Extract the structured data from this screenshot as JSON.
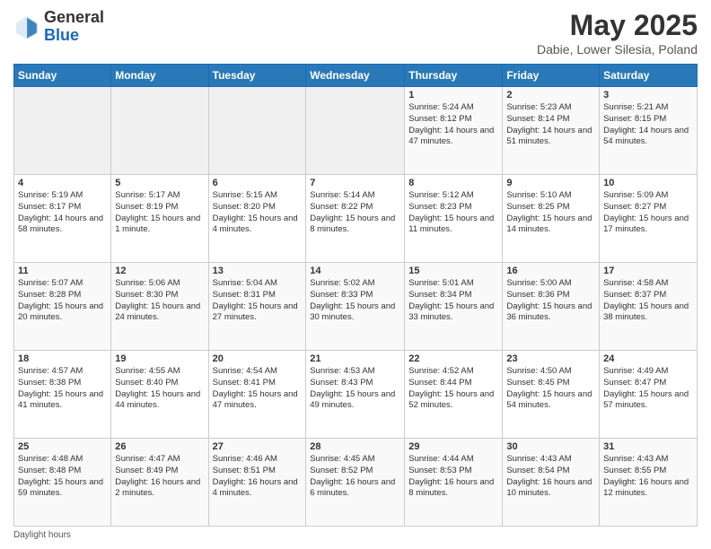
{
  "header": {
    "logo_general": "General",
    "logo_blue": "Blue",
    "month_title": "May 2025",
    "location": "Dabie, Lower Silesia, Poland"
  },
  "days_of_week": [
    "Sunday",
    "Monday",
    "Tuesday",
    "Wednesday",
    "Thursday",
    "Friday",
    "Saturday"
  ],
  "weeks": [
    [
      {
        "num": "",
        "info": ""
      },
      {
        "num": "",
        "info": ""
      },
      {
        "num": "",
        "info": ""
      },
      {
        "num": "",
        "info": ""
      },
      {
        "num": "1",
        "info": "Sunrise: 5:24 AM\nSunset: 8:12 PM\nDaylight: 14 hours\nand 47 minutes."
      },
      {
        "num": "2",
        "info": "Sunrise: 5:23 AM\nSunset: 8:14 PM\nDaylight: 14 hours\nand 51 minutes."
      },
      {
        "num": "3",
        "info": "Sunrise: 5:21 AM\nSunset: 8:15 PM\nDaylight: 14 hours\nand 54 minutes."
      }
    ],
    [
      {
        "num": "4",
        "info": "Sunrise: 5:19 AM\nSunset: 8:17 PM\nDaylight: 14 hours\nand 58 minutes."
      },
      {
        "num": "5",
        "info": "Sunrise: 5:17 AM\nSunset: 8:19 PM\nDaylight: 15 hours\nand 1 minute."
      },
      {
        "num": "6",
        "info": "Sunrise: 5:15 AM\nSunset: 8:20 PM\nDaylight: 15 hours\nand 4 minutes."
      },
      {
        "num": "7",
        "info": "Sunrise: 5:14 AM\nSunset: 8:22 PM\nDaylight: 15 hours\nand 8 minutes."
      },
      {
        "num": "8",
        "info": "Sunrise: 5:12 AM\nSunset: 8:23 PM\nDaylight: 15 hours\nand 11 minutes."
      },
      {
        "num": "9",
        "info": "Sunrise: 5:10 AM\nSunset: 8:25 PM\nDaylight: 15 hours\nand 14 minutes."
      },
      {
        "num": "10",
        "info": "Sunrise: 5:09 AM\nSunset: 8:27 PM\nDaylight: 15 hours\nand 17 minutes."
      }
    ],
    [
      {
        "num": "11",
        "info": "Sunrise: 5:07 AM\nSunset: 8:28 PM\nDaylight: 15 hours\nand 20 minutes."
      },
      {
        "num": "12",
        "info": "Sunrise: 5:06 AM\nSunset: 8:30 PM\nDaylight: 15 hours\nand 24 minutes."
      },
      {
        "num": "13",
        "info": "Sunrise: 5:04 AM\nSunset: 8:31 PM\nDaylight: 15 hours\nand 27 minutes."
      },
      {
        "num": "14",
        "info": "Sunrise: 5:02 AM\nSunset: 8:33 PM\nDaylight: 15 hours\nand 30 minutes."
      },
      {
        "num": "15",
        "info": "Sunrise: 5:01 AM\nSunset: 8:34 PM\nDaylight: 15 hours\nand 33 minutes."
      },
      {
        "num": "16",
        "info": "Sunrise: 5:00 AM\nSunset: 8:36 PM\nDaylight: 15 hours\nand 36 minutes."
      },
      {
        "num": "17",
        "info": "Sunrise: 4:58 AM\nSunset: 8:37 PM\nDaylight: 15 hours\nand 38 minutes."
      }
    ],
    [
      {
        "num": "18",
        "info": "Sunrise: 4:57 AM\nSunset: 8:38 PM\nDaylight: 15 hours\nand 41 minutes."
      },
      {
        "num": "19",
        "info": "Sunrise: 4:55 AM\nSunset: 8:40 PM\nDaylight: 15 hours\nand 44 minutes."
      },
      {
        "num": "20",
        "info": "Sunrise: 4:54 AM\nSunset: 8:41 PM\nDaylight: 15 hours\nand 47 minutes."
      },
      {
        "num": "21",
        "info": "Sunrise: 4:53 AM\nSunset: 8:43 PM\nDaylight: 15 hours\nand 49 minutes."
      },
      {
        "num": "22",
        "info": "Sunrise: 4:52 AM\nSunset: 8:44 PM\nDaylight: 15 hours\nand 52 minutes."
      },
      {
        "num": "23",
        "info": "Sunrise: 4:50 AM\nSunset: 8:45 PM\nDaylight: 15 hours\nand 54 minutes."
      },
      {
        "num": "24",
        "info": "Sunrise: 4:49 AM\nSunset: 8:47 PM\nDaylight: 15 hours\nand 57 minutes."
      }
    ],
    [
      {
        "num": "25",
        "info": "Sunrise: 4:48 AM\nSunset: 8:48 PM\nDaylight: 15 hours\nand 59 minutes."
      },
      {
        "num": "26",
        "info": "Sunrise: 4:47 AM\nSunset: 8:49 PM\nDaylight: 16 hours\nand 2 minutes."
      },
      {
        "num": "27",
        "info": "Sunrise: 4:46 AM\nSunset: 8:51 PM\nDaylight: 16 hours\nand 4 minutes."
      },
      {
        "num": "28",
        "info": "Sunrise: 4:45 AM\nSunset: 8:52 PM\nDaylight: 16 hours\nand 6 minutes."
      },
      {
        "num": "29",
        "info": "Sunrise: 4:44 AM\nSunset: 8:53 PM\nDaylight: 16 hours\nand 8 minutes."
      },
      {
        "num": "30",
        "info": "Sunrise: 4:43 AM\nSunset: 8:54 PM\nDaylight: 16 hours\nand 10 minutes."
      },
      {
        "num": "31",
        "info": "Sunrise: 4:43 AM\nSunset: 8:55 PM\nDaylight: 16 hours\nand 12 minutes."
      }
    ]
  ],
  "footer": {
    "note": "Daylight hours"
  }
}
